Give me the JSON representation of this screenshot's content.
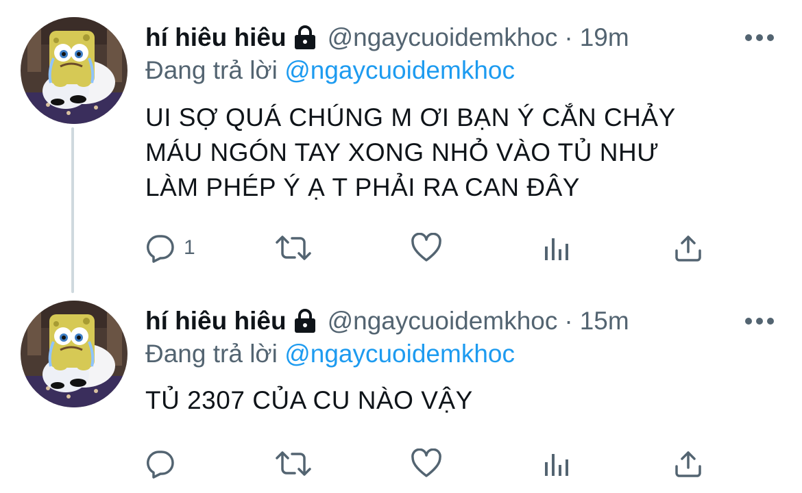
{
  "tweets": [
    {
      "display_name": "hí hiêu hiêu",
      "handle": "@ngaycuoidemkhoc",
      "separator": "·",
      "time": "19m",
      "reply_prefix": "Đang trả lời",
      "reply_to": "@ngaycuoidemkhoc",
      "text_lines": [
        "UI SỢ QUÁ CHÚNG M ƠI BẠN Ý CẮN CHẢY",
        "MÁU NGÓN TAY XONG NHỎ VÀO TỦ NHƯ",
        "LÀM PHÉP Ý Ạ T PHẢI RA CAN ĐÂY"
      ],
      "reply_count": "1",
      "icons": [
        "lock-icon",
        "more-icon",
        "reply-icon",
        "retweet-icon",
        "like-icon",
        "stats-icon",
        "share-icon"
      ]
    },
    {
      "display_name": "hí hiêu hiêu",
      "handle": "@ngaycuoidemkhoc",
      "separator": "·",
      "time": "15m",
      "reply_prefix": "Đang trả lời",
      "reply_to": "@ngaycuoidemkhoc",
      "text_lines": [
        "TỦ 2307 CỦA CU NÀO VẬY"
      ],
      "reply_count": "",
      "icons": [
        "lock-icon",
        "more-icon",
        "reply-icon",
        "retweet-icon",
        "like-icon",
        "stats-icon",
        "share-icon"
      ]
    }
  ],
  "colors": {
    "text": "#0f1419",
    "secondary": "#536471",
    "link": "#1d9bf0",
    "thread_line": "#cfd9de"
  }
}
